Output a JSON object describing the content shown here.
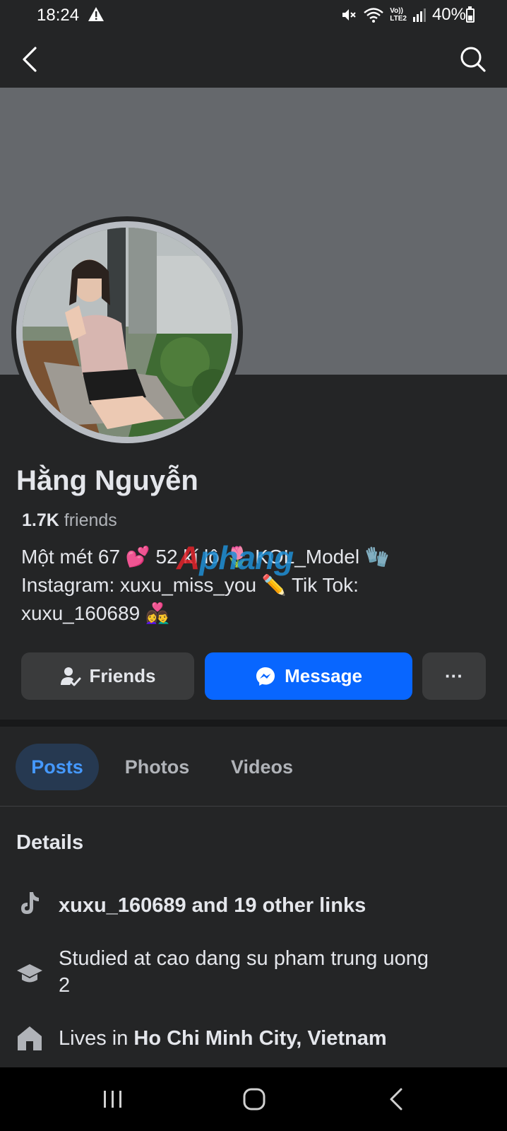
{
  "status_bar": {
    "time": "18:24",
    "battery": "40%",
    "network": "LTE2",
    "volte": "Vo))"
  },
  "profile": {
    "name": "Hằng Nguyễn",
    "friends_count": "1.7K",
    "friends_label": " friends",
    "bio_lines": [
      "Một mét 67 💕 52 kí lô 🌷 KOL_Model 🧤",
      "Instagram: xuxu_miss_you ✏️ Tik Tok:",
      "xuxu_160689 👩‍❤️‍👨"
    ],
    "watermark_red": "A",
    "watermark_blue": "phang"
  },
  "actions": {
    "friends_label": "Friends",
    "message_label": "Message",
    "more_label": "···"
  },
  "tabs": [
    {
      "label": "Posts",
      "active": true
    },
    {
      "label": "Photos",
      "active": false
    },
    {
      "label": "Videos",
      "active": false
    }
  ],
  "details": {
    "title": "Details",
    "links": "xuxu_160689 and 19 other links",
    "studied_prefix": "Studied at cao dang su pham trung uong",
    "studied_suffix": "2",
    "lives_prefix": "Lives in ",
    "lives_place": "Ho Chi Minh City, Vietnam"
  },
  "colors": {
    "background": "#242526",
    "cover": "#65686c",
    "accent": "#0866ff",
    "tab_active_bg": "#263951",
    "tab_active_text": "#4599ff"
  }
}
